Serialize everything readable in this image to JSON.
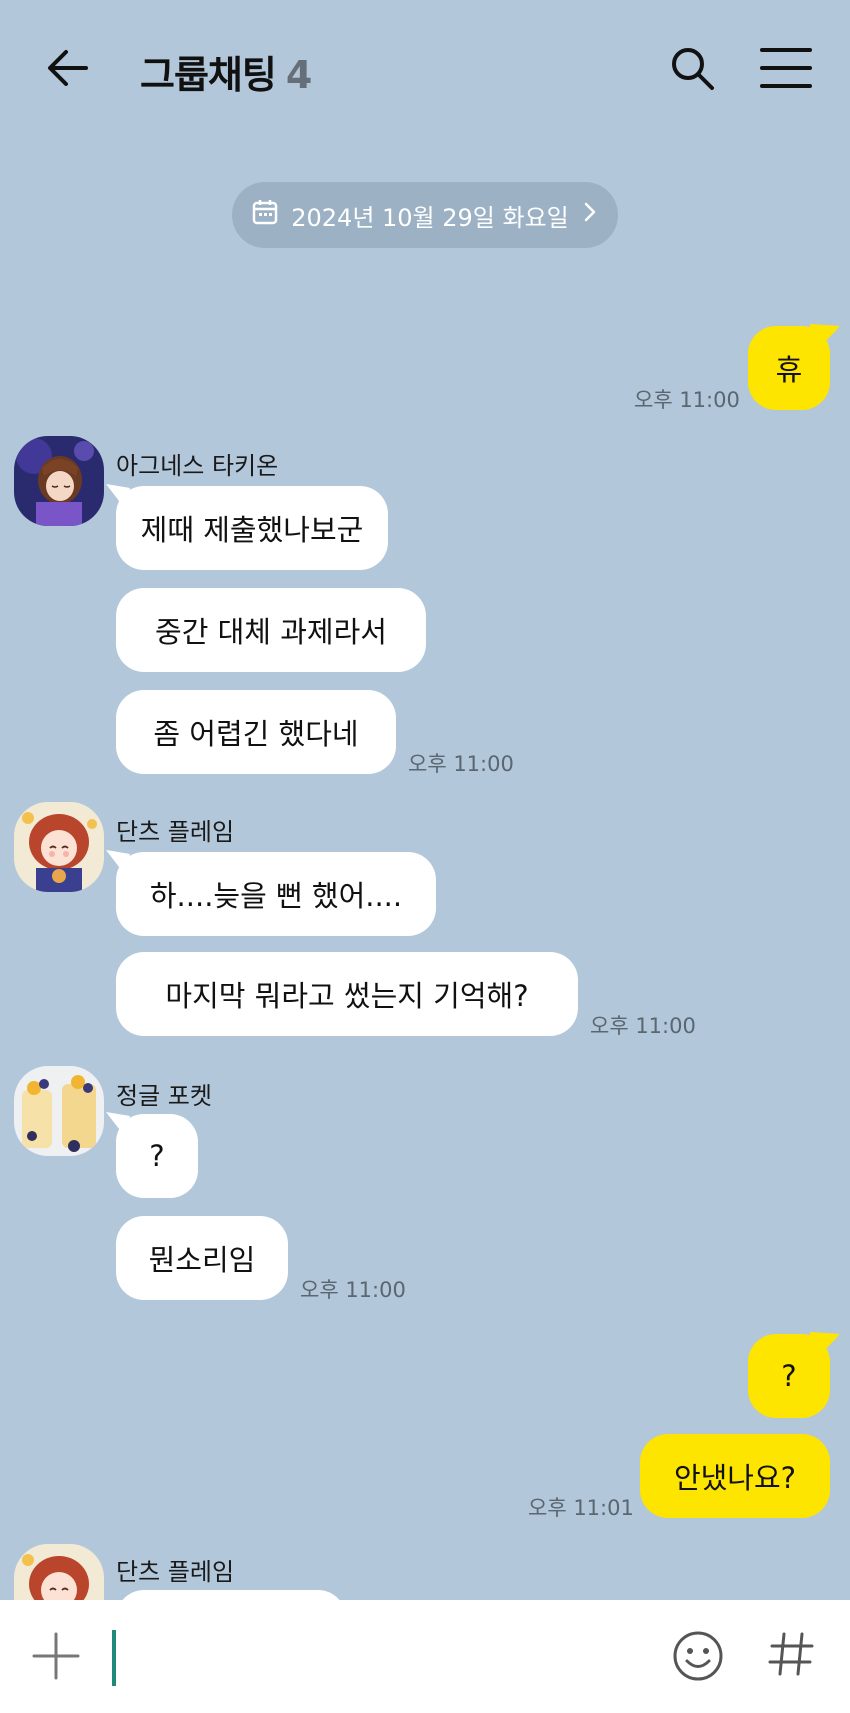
{
  "header": {
    "title": "그룹채팅",
    "member_count": "4"
  },
  "date_divider": {
    "label": "2024년 10월 29일 화요일"
  },
  "messages": [
    {
      "type": "out",
      "text": "휴",
      "time": "오후 11:00"
    },
    {
      "type": "group_in",
      "sender": "아그네스 타키온",
      "bubbles": [
        "제때 제출했나보군",
        "중간 대체 과제라서",
        "좀 어렵긴 했다네"
      ],
      "time": "오후 11:00"
    },
    {
      "type": "group_in",
      "sender": "단츠 플레임",
      "bubbles": [
        "하....늦을 뻔 했어....",
        "마지막 뭐라고 썼는지 기억해?"
      ],
      "time": "오후 11:00"
    },
    {
      "type": "group_in",
      "sender": "정글 포켓",
      "bubbles": [
        "?",
        "뭔소리임"
      ],
      "time": "오후 11:00"
    },
    {
      "type": "out_group",
      "bubbles": [
        "?",
        "안냈나요?"
      ],
      "time": "오후 11:01"
    },
    {
      "type": "group_in_partial",
      "sender": "단츠 플레임"
    }
  ],
  "input": {
    "placeholder": ""
  },
  "colors": {
    "background": "#b2c7da",
    "my_bubble": "#fee500",
    "their_bubble": "#ffffff",
    "date_pill": "#9cb1c4",
    "caret": "#1f8a7a"
  },
  "icons": [
    "back-arrow-icon",
    "search-icon",
    "hamburger-menu-icon",
    "calendar-icon",
    "chevron-right-icon",
    "plus-icon",
    "emoji-icon",
    "hashtag-icon"
  ]
}
